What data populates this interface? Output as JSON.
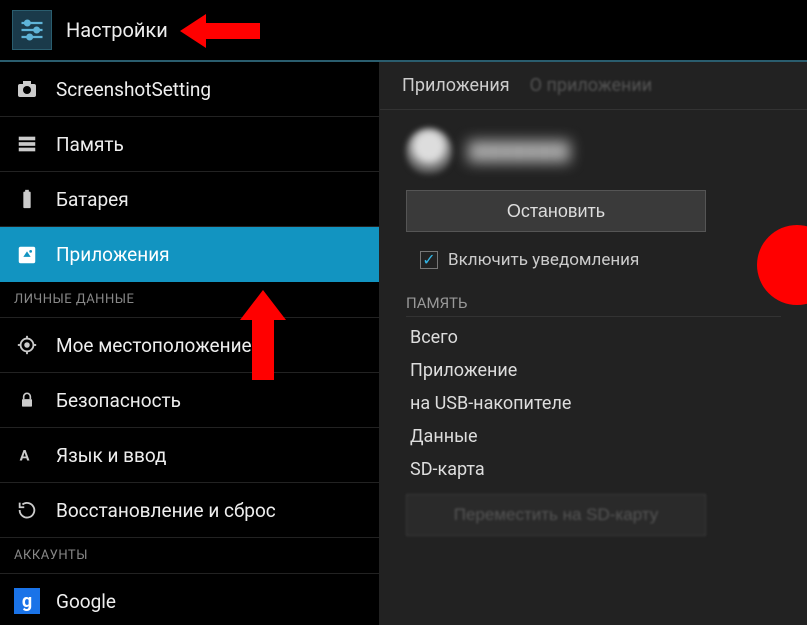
{
  "header": {
    "title": "Настройки"
  },
  "sidebar": {
    "items": [
      {
        "icon": "camera",
        "label": "ScreenshotSetting"
      },
      {
        "icon": "storage",
        "label": "Память"
      },
      {
        "icon": "battery",
        "label": "Батарея"
      },
      {
        "icon": "apps",
        "label": "Приложения",
        "selected": true
      }
    ],
    "section_personal": "ЛИЧНЫЕ ДАННЫЕ",
    "personal_items": [
      {
        "icon": "location",
        "label": "Мое местоположение"
      },
      {
        "icon": "lock",
        "label": "Безопасность"
      },
      {
        "icon": "language",
        "label": "Язык и ввод"
      },
      {
        "icon": "reset",
        "label": "Восстановление и сброс"
      }
    ],
    "section_accounts": "АККАУНТЫ",
    "account_items": [
      {
        "icon": "google",
        "label": "Google"
      }
    ]
  },
  "detail": {
    "tabs": {
      "active": "Приложения",
      "inactive": "О приложении"
    },
    "stop_button": "Остановить",
    "notifications_checkbox": "Включить уведомления",
    "memory_header": "ПАМЯТЬ",
    "memory_rows": [
      "Всего",
      "Приложение",
      "на USB-накопителе",
      "Данные",
      "SD-карта"
    ],
    "move_button": "Переместить на SD-карту"
  }
}
